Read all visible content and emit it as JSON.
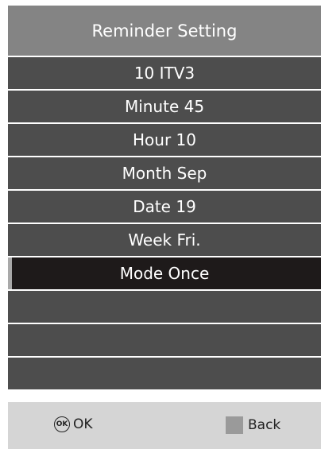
{
  "header": {
    "title": "Reminder Setting"
  },
  "rows": [
    {
      "label": "10 ITV3"
    },
    {
      "label": "Minute 45"
    },
    {
      "label": "Hour 10"
    },
    {
      "label": "Month Sep"
    },
    {
      "label": "Date 19"
    },
    {
      "label": "Week Fri."
    },
    {
      "label": "Mode Once",
      "selected": true
    },
    {
      "label": ""
    },
    {
      "label": ""
    },
    {
      "label": ""
    }
  ],
  "footer": {
    "ok_icon": "OK",
    "ok_label": "OK",
    "back_label": "Back"
  },
  "colors": {
    "header_bg": "#848484",
    "row_bg": "#4d4d4d",
    "selected_bg": "#1e1a1a",
    "footer_bg": "#d5d5d5",
    "back_key": "#9a9a9a"
  }
}
